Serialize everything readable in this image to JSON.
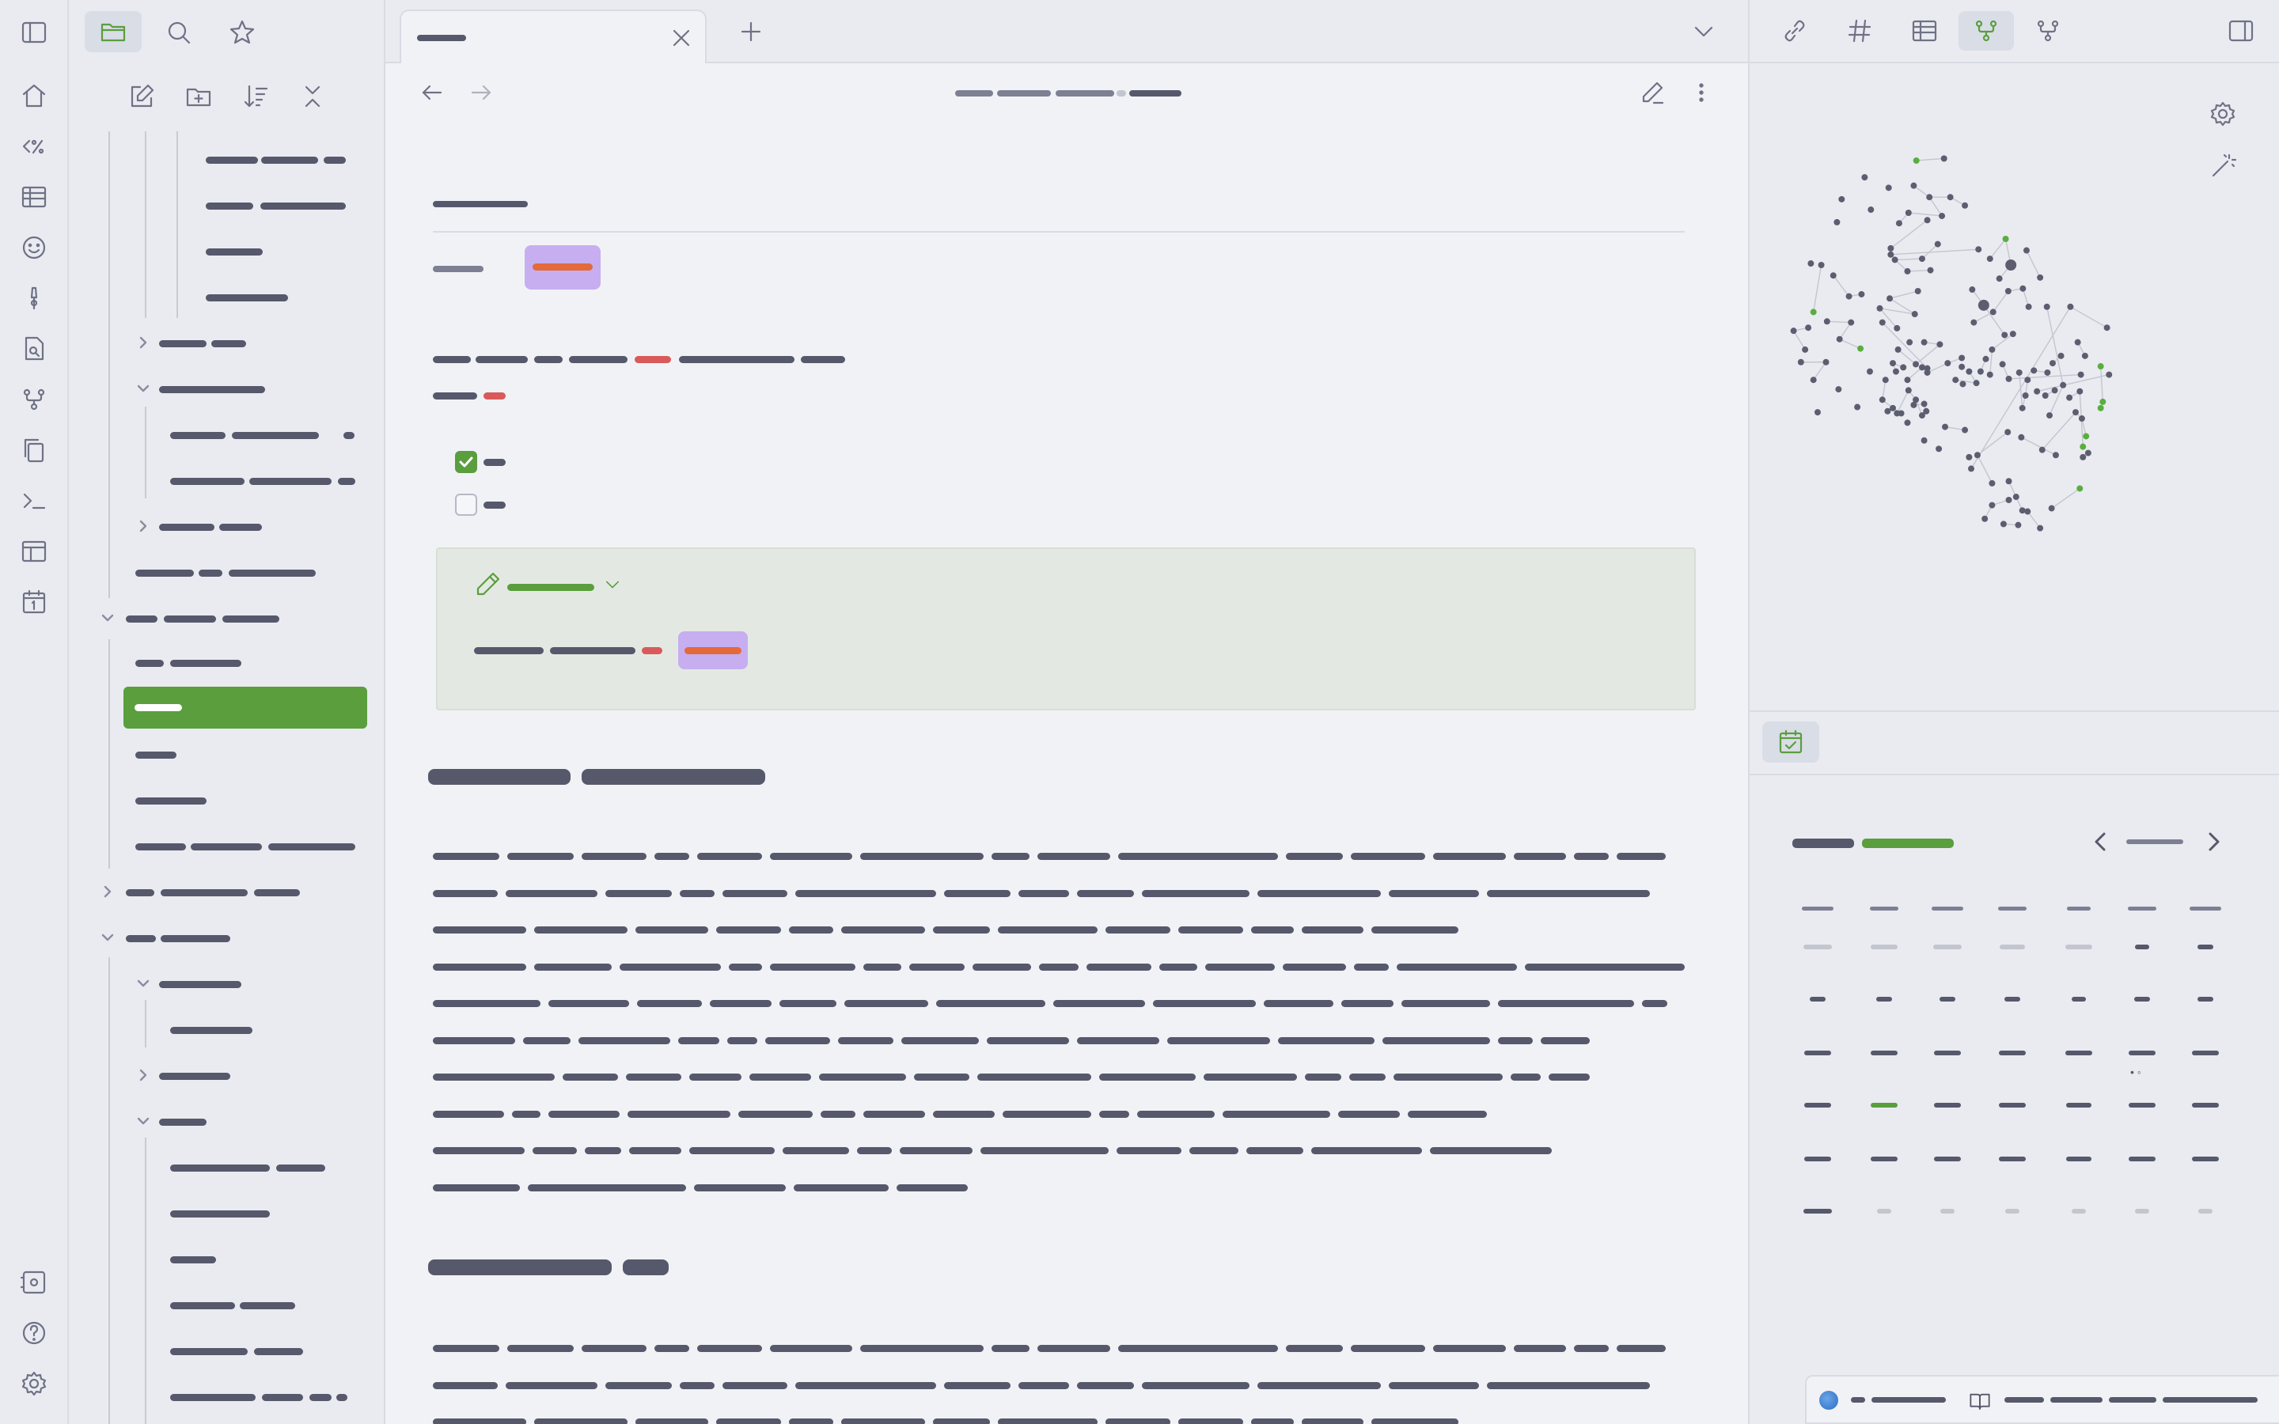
{
  "ribbon": {
    "items": [
      {
        "name": "home-icon",
        "glyph": "home"
      },
      {
        "name": "templater-icon",
        "glyph": "<%"
      },
      {
        "name": "table-icon",
        "glyph": "table"
      },
      {
        "name": "smiley-icon",
        "glyph": "smile"
      },
      {
        "name": "pin-icon",
        "glyph": "pin"
      },
      {
        "name": "search-file-icon",
        "glyph": "search-file"
      },
      {
        "name": "graph-icon",
        "glyph": "graph"
      },
      {
        "name": "copy-icon",
        "glyph": "copy"
      },
      {
        "name": "terminal-icon",
        "glyph": "terminal"
      },
      {
        "name": "layout-icon",
        "glyph": "layout"
      },
      {
        "name": "calendar-icon",
        "glyph": "1"
      }
    ],
    "bottom": [
      {
        "name": "vault-switch-icon"
      },
      {
        "name": "help-icon",
        "glyph": "?"
      },
      {
        "name": "settings-icon"
      }
    ]
  },
  "editor": {
    "nav_back": "back",
    "nav_forward": "forward",
    "properties_label": "",
    "callout_icon": "pencil",
    "check_items": [
      {
        "checked": true
      },
      {
        "checked": false
      }
    ]
  },
  "calendar": {
    "today_dot": "◦",
    "prev": "previous",
    "next": "next"
  },
  "colors": {
    "accent": "#5a9e3e",
    "tag_bg": "#c6aef0",
    "tag_text": "#e46a3a",
    "link_red": "#d95a5a",
    "text": "#56586b"
  }
}
